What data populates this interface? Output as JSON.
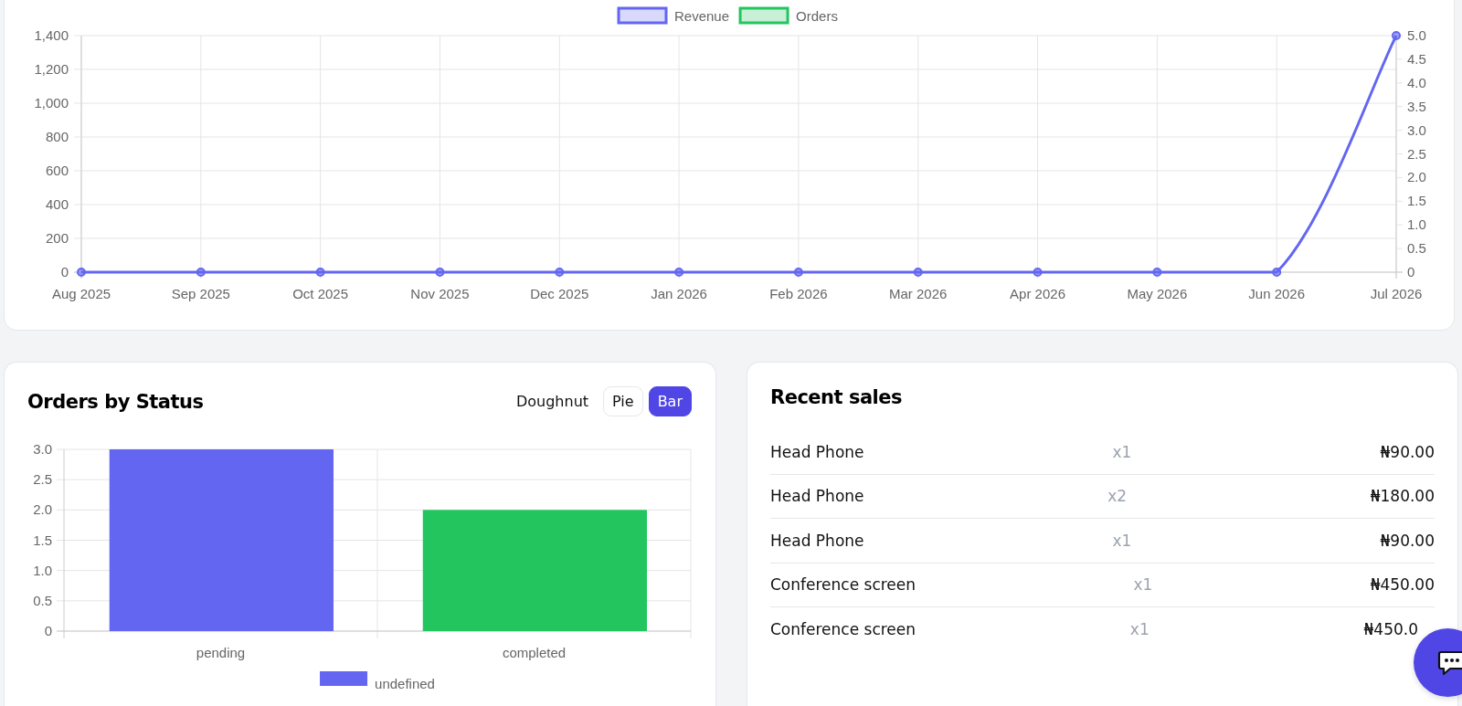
{
  "revenue_chart": {
    "chart_data": {
      "type": "line",
      "categories": [
        "Aug 2025",
        "Sep 2025",
        "Oct 2025",
        "Nov 2025",
        "Dec 2025",
        "Jan 2026",
        "Feb 2026",
        "Mar 2026",
        "Apr 2026",
        "May 2026",
        "Jun 2026",
        "Jul 2026"
      ],
      "grid": true,
      "legend": true,
      "series": [
        {
          "name": "Revenue",
          "color": "#6366f1",
          "marker": "circle",
          "values": [
            0,
            0,
            0,
            0,
            0,
            0,
            0,
            0,
            0,
            0,
            0,
            1400
          ]
        },
        {
          "name": "Orders",
          "color": "#22c55e",
          "values": [
            null,
            null,
            null,
            null,
            null,
            null,
            null,
            null,
            null,
            null,
            null,
            null
          ]
        }
      ],
      "ylim": [
        0,
        1400
      ],
      "yticks": [
        {
          "value": 0,
          "label": "0"
        },
        {
          "value": 200,
          "label": "200"
        },
        {
          "value": 400,
          "label": "400"
        },
        {
          "value": 600,
          "label": "600"
        },
        {
          "value": 800,
          "label": "800"
        },
        {
          "value": 1000,
          "label": "1,000"
        },
        {
          "value": 1200,
          "label": "1,200"
        },
        {
          "value": 1400,
          "label": "1,400"
        }
      ],
      "y2lim": [
        0,
        5
      ],
      "y2ticks": [
        {
          "value": 0,
          "label": "0"
        },
        {
          "value": 0.5,
          "label": "0.5"
        },
        {
          "value": 1,
          "label": "1.0"
        },
        {
          "value": 1.5,
          "label": "1.5"
        },
        {
          "value": 2,
          "label": "2.0"
        },
        {
          "value": 2.5,
          "label": "2.5"
        },
        {
          "value": 3,
          "label": "3.0"
        },
        {
          "value": 3.5,
          "label": "3.5"
        },
        {
          "value": 4,
          "label": "4.0"
        },
        {
          "value": 4.5,
          "label": "4.5"
        },
        {
          "value": 5,
          "label": "5.0"
        }
      ]
    }
  },
  "orders_by_status": {
    "title": "Orders by Status",
    "chart_types": [
      {
        "label": "Doughnut",
        "selected": false
      },
      {
        "label": "Pie",
        "selected": false
      },
      {
        "label": "Bar",
        "selected": true
      }
    ],
    "chart_data": {
      "type": "bar",
      "categories": [
        "pending",
        "completed"
      ],
      "grid": true,
      "legend": true,
      "series": [
        {
          "name": "undefined",
          "colors": [
            "#6366f1",
            "#22c55e"
          ],
          "values": [
            3,
            2
          ]
        }
      ],
      "ylim": [
        0,
        3
      ],
      "yticks": [
        {
          "value": 0,
          "label": "0"
        },
        {
          "value": 0.5,
          "label": "0.5"
        },
        {
          "value": 1,
          "label": "1.0"
        },
        {
          "value": 1.5,
          "label": "1.5"
        },
        {
          "value": 2,
          "label": "2.0"
        },
        {
          "value": 2.5,
          "label": "2.5"
        },
        {
          "value": 3,
          "label": "3.0"
        }
      ]
    }
  },
  "recent_sales": {
    "title": "Recent sales",
    "rows": [
      {
        "product": "Head Phone",
        "quantity": "x1",
        "amount": "₦90.00"
      },
      {
        "product": "Head Phone",
        "quantity": "x2",
        "amount": "₦180.00"
      },
      {
        "product": "Head Phone",
        "quantity": "x1",
        "amount": "₦90.00"
      },
      {
        "product": "Conference screen",
        "quantity": "x1",
        "amount": "₦450.00"
      },
      {
        "product": "Conference screen",
        "quantity": "x1",
        "amount": "₦450.0"
      }
    ]
  }
}
